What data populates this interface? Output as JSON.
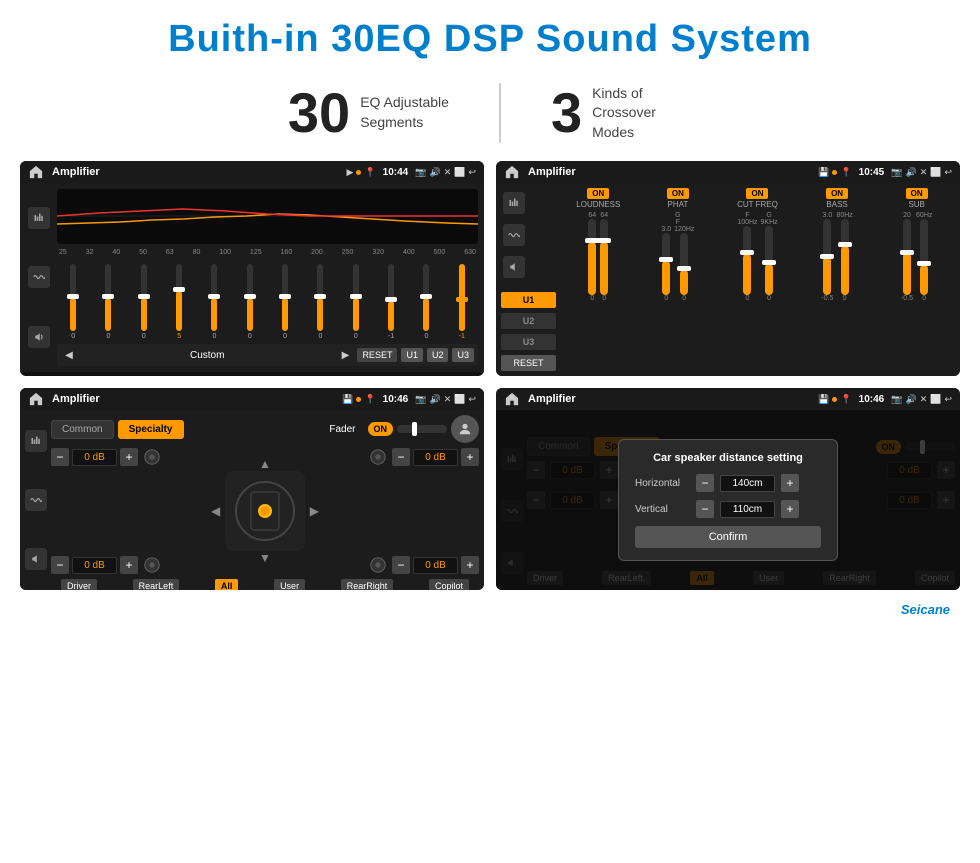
{
  "page": {
    "title": "Buith-in 30EQ DSP Sound System",
    "stat1_num": "30",
    "stat1_label_line1": "EQ Adjustable",
    "stat1_label_line2": "Segments",
    "stat2_num": "3",
    "stat2_label_line1": "Kinds of",
    "stat2_label_line2": "Crossover Modes",
    "watermark": "Seicane"
  },
  "screen1": {
    "title": "Amplifier",
    "time": "10:44",
    "preset": "Custom",
    "reset_btn": "RESET",
    "u1_btn": "U1",
    "u2_btn": "U2",
    "u3_btn": "U3",
    "freq_labels": [
      "25",
      "32",
      "40",
      "50",
      "63",
      "80",
      "100",
      "125",
      "160",
      "200",
      "250",
      "320",
      "400",
      "500",
      "630"
    ],
    "slider_values": [
      "0",
      "0",
      "0",
      "5",
      "0",
      "0",
      "0",
      "0",
      "0",
      "-1",
      "0",
      "-1"
    ]
  },
  "screen2": {
    "title": "Amplifier",
    "time": "10:45",
    "u1": "U1",
    "u2": "U2",
    "u3": "U3",
    "reset": "RESET",
    "col_labels": [
      "LOUDNESS",
      "PHAT",
      "CUT FREQ",
      "BASS",
      "SUB"
    ],
    "on_badges": [
      "ON",
      "ON",
      "ON",
      "ON",
      "ON"
    ]
  },
  "screen3": {
    "title": "Amplifier",
    "time": "10:46",
    "tab_common": "Common",
    "tab_specialty": "Specialty",
    "fader_label": "Fader",
    "fader_toggle": "ON",
    "db_values": [
      "0 dB",
      "0 dB",
      "0 dB",
      "0 dB"
    ],
    "btn_driver": "Driver",
    "btn_rearleft": "RearLeft",
    "btn_all": "All",
    "btn_user": "User",
    "btn_rearright": "RearRight",
    "btn_copilot": "Copilot"
  },
  "screen4": {
    "title": "Amplifier",
    "time": "10:46",
    "tab_common": "Common",
    "tab_specialty": "Specialty",
    "dialog_title": "Car speaker distance setting",
    "horizontal_label": "Horizontal",
    "horizontal_value": "140cm",
    "vertical_label": "Vertical",
    "vertical_value": "110cm",
    "db_val1": "0 dB",
    "db_val2": "0 dB",
    "confirm_btn": "Confirm",
    "btn_driver": "Driver",
    "btn_rearleft": "RearLeft.",
    "btn_copilot": "Copilot",
    "btn_rearright": "RearRight"
  }
}
